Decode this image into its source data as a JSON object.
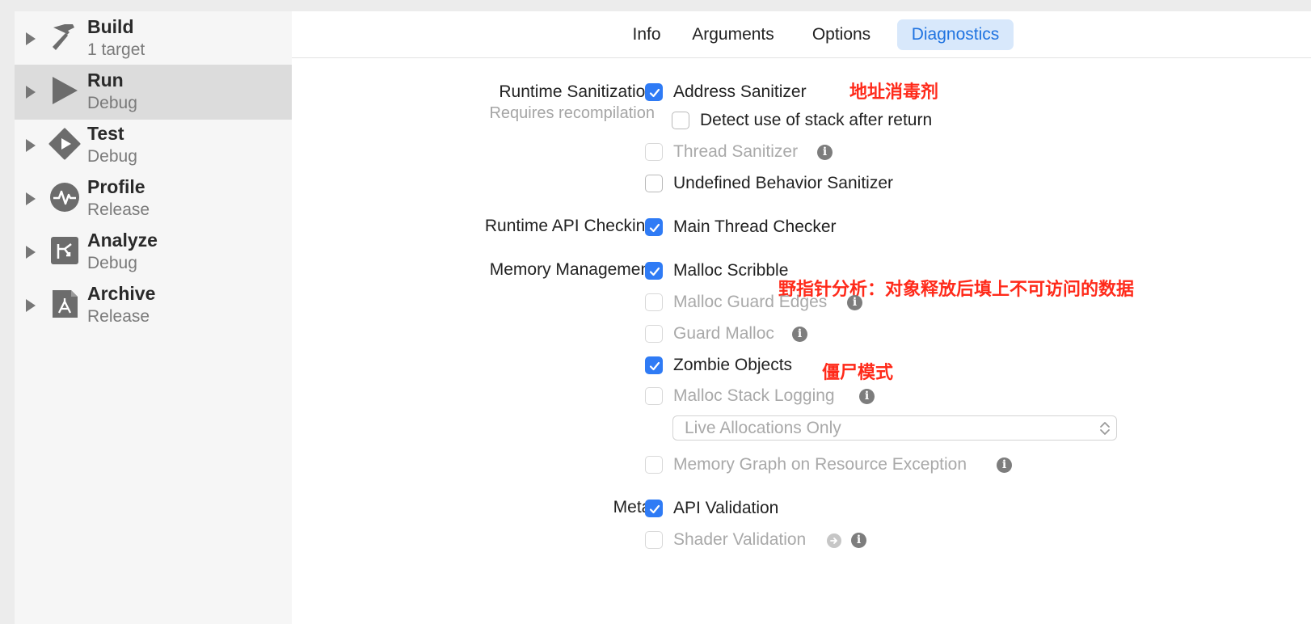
{
  "sidebar": {
    "items": [
      {
        "title": "Build",
        "subtitle": "1 target",
        "icon": "hammer-icon",
        "selected": false
      },
      {
        "title": "Run",
        "subtitle": "Debug",
        "icon": "play-icon",
        "selected": true
      },
      {
        "title": "Test",
        "subtitle": "Debug",
        "icon": "test-diamond-icon",
        "selected": false
      },
      {
        "title": "Profile",
        "subtitle": "Release",
        "icon": "waveform-icon",
        "selected": false
      },
      {
        "title": "Analyze",
        "subtitle": "Debug",
        "icon": "analyze-icon",
        "selected": false
      },
      {
        "title": "Archive",
        "subtitle": "Release",
        "icon": "archive-icon",
        "selected": false
      }
    ]
  },
  "tabs": {
    "info": "Info",
    "arguments": "Arguments",
    "options": "Options",
    "diagnostics": "Diagnostics",
    "active": "Diagnostics"
  },
  "sections": {
    "runtime_sanitization": {
      "label": "Runtime Sanitization",
      "sublabel": "Requires recompilation",
      "address_sanitizer": {
        "label": "Address Sanitizer",
        "checked": true,
        "enabled": true
      },
      "detect_stack": {
        "label": "Detect use of stack after return",
        "checked": false,
        "enabled": true
      },
      "thread_sanitizer": {
        "label": "Thread Sanitizer",
        "checked": false,
        "enabled": false
      },
      "undefined_behavior": {
        "label": "Undefined Behavior Sanitizer",
        "checked": false,
        "enabled": true
      }
    },
    "runtime_api": {
      "label": "Runtime API Checking",
      "main_thread_checker": {
        "label": "Main Thread Checker",
        "checked": true,
        "enabled": true
      }
    },
    "memory_management": {
      "label": "Memory Management",
      "malloc_scribble": {
        "label": "Malloc Scribble",
        "checked": true,
        "enabled": true
      },
      "malloc_guard_edges": {
        "label": "Malloc Guard Edges",
        "checked": false,
        "enabled": false
      },
      "guard_malloc": {
        "label": "Guard Malloc",
        "checked": false,
        "enabled": false
      },
      "zombie_objects": {
        "label": "Zombie Objects",
        "checked": true,
        "enabled": true
      },
      "malloc_stack_logging": {
        "label": "Malloc Stack Logging",
        "checked": false,
        "enabled": false
      },
      "allocations_popup": "Live Allocations Only",
      "memory_graph": {
        "label": "Memory Graph on Resource Exception",
        "checked": false,
        "enabled": false
      }
    },
    "metal": {
      "label": "Metal",
      "api_validation": {
        "label": "API Validation",
        "checked": true,
        "enabled": true
      },
      "shader_validation": {
        "label": "Shader Validation",
        "checked": false,
        "enabled": false
      }
    }
  },
  "annotations": {
    "address_sanitizer_note": "地址消毒剂",
    "malloc_scribble_note": "野指针分析：对象释放后填上不可访问的数据",
    "zombie_note": "僵尸模式"
  },
  "colors": {
    "accent": "#2f7bf5",
    "annotation": "#ff2a1a",
    "selected_row": "#dcdcdc",
    "active_tab_bg": "#d8e8fb"
  }
}
